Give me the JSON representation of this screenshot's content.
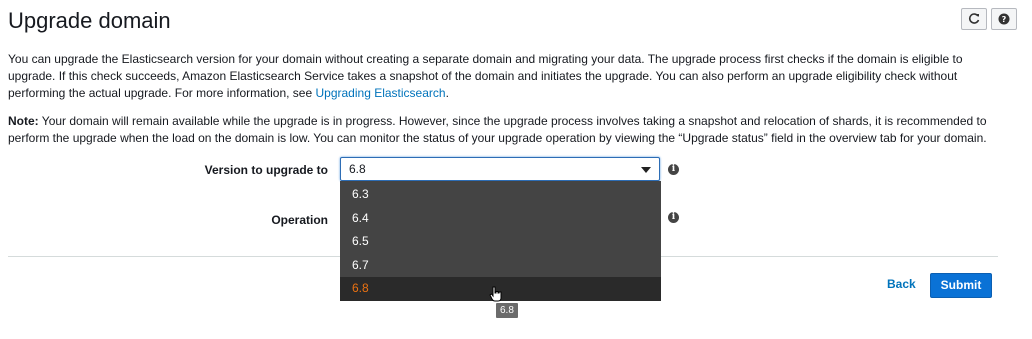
{
  "page": {
    "title": "Upgrade domain"
  },
  "toolbar": {
    "refresh_icon": "refresh-icon",
    "help_icon": "help-icon"
  },
  "intro": {
    "text": "You can upgrade the Elasticsearch version for your domain without creating a separate domain and migrating your data. The upgrade process first checks if the domain is eligible to upgrade. If this check succeeds, Amazon Elasticsearch Service takes a snapshot of the domain and initiates the upgrade. You can also perform an upgrade eligibility check without performing the actual upgrade. For more information, see ",
    "link": "Upgrading Elasticsearch",
    "suffix": "."
  },
  "note": {
    "label": "Note:",
    "text": " Your domain will remain available while the upgrade is in progress. However, since the upgrade process involves taking a snapshot and relocation of shards, it is recommended to perform the upgrade when the load on the domain is low. You can monitor the status of your upgrade operation by viewing the “Upgrade status” field in the overview tab for your domain."
  },
  "form": {
    "version_label": "Version to upgrade to",
    "version_value": "6.8",
    "operation_label": "Operation",
    "options": [
      "6.3",
      "6.4",
      "6.5",
      "6.7",
      "6.8"
    ],
    "selected_option": "6.8",
    "tooltip": "6.8"
  },
  "actions": {
    "back": "Back",
    "submit": "Submit"
  },
  "colors": {
    "accent": "#0073bb",
    "primary_button": "#0a72d6",
    "selected_option": "#ec7211",
    "dropdown_bg": "#444444"
  }
}
